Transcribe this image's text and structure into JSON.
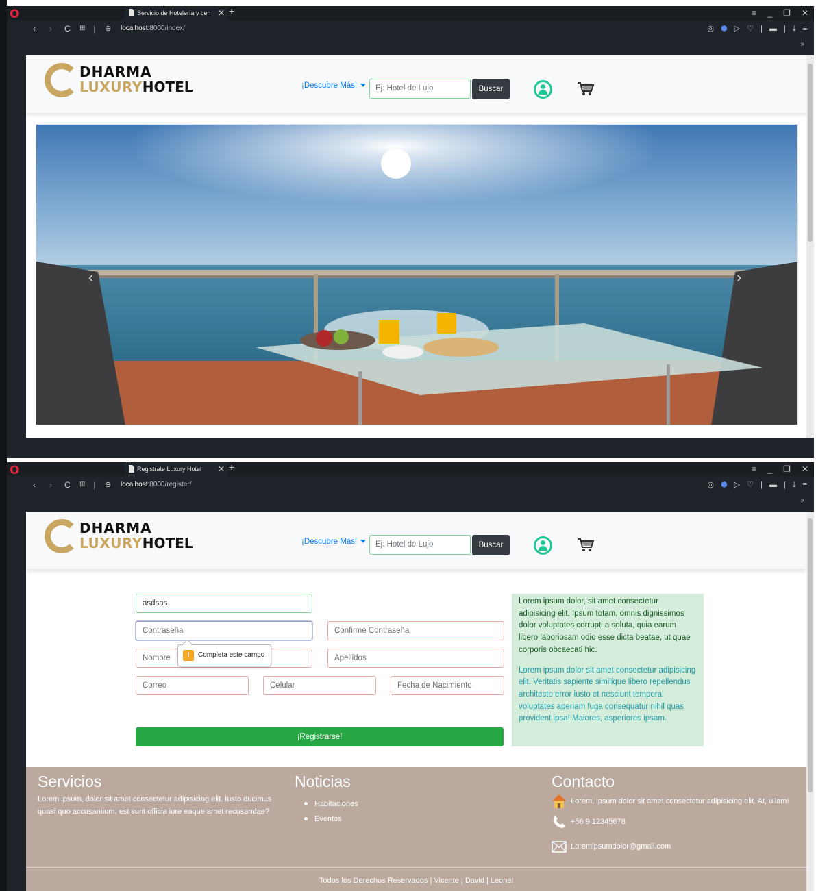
{
  "windows": [
    {
      "tab_title": "Servicio de Hotelería y cen",
      "url_host": "localhost",
      "url_rest": ":8000/index/"
    },
    {
      "tab_title": "Registrate Luxury Hotel",
      "url_host": "localhost",
      "url_rest": ":8000/register/"
    }
  ],
  "header": {
    "logo_line1": "DHARMA",
    "logo_luxury": "LUXURY",
    "logo_hotel": "HOTEL",
    "discover_label": "¡Descubre Más!",
    "search_placeholder": "Ej: Hotel de Lujo",
    "search_button": "Buscar"
  },
  "register": {
    "username_value": "asdsas",
    "password_placeholder": "Contraseña",
    "confirm_placeholder": "Confirme Contraseña",
    "nombre_placeholder": "Nombre",
    "apellidos_placeholder": "Apellidos",
    "correo_placeholder": "Correo",
    "celular_placeholder": "Celular",
    "fecha_placeholder": "Fecha de Nacimiento",
    "submit_label": "¡Registrarse!",
    "validation_tooltip": "Completa este campo"
  },
  "info_panel": {
    "paragraph1": "Lorem ipsum dolor, sit amet consectetur adipisicing elit. Ipsum totam, omnis dignissimos dolor voluptates corrupti a soluta, quia earum libero laboriosam odio esse dicta beatae, ut quae corporis obcaecati hic.",
    "paragraph2": "Lorem ipsum dolor sit amet consectetur adipisicing elit. Veritatis sapiente similique libero repellendus architecto error iusto et nesciunt tempora, voluptates aperiam fuga consequatur nihil quas provident ipsa! Maiores, asperiores ipsam."
  },
  "footer": {
    "servicios_title": "Servicios",
    "servicios_text": "Lorem ipsum, dolor sit amet consectetur adipisicing elit. Iusto ducimus quasi quo accusantium, est sunt officia iure eaque amet recusandae?",
    "noticias_title": "Noticias",
    "noticias_items": [
      "Habitaciones",
      "Eventos"
    ],
    "contacto_title": "Contacto",
    "contact_address": "Lorem, ipsum dolor sit amet consectetur adipisicing elit. At, ullam!",
    "contact_phone": "+56 9 12345678",
    "contact_email": "Loremipsumdolor@gmail.com",
    "copyright": "Todos los Derechos Reservados | Vicente | David | Leonel"
  },
  "colors": {
    "accent_green": "#28a745",
    "logo_gold": "#c9a763",
    "footer_bg": "#bba9a0",
    "panel_bg": "#d4edda",
    "user_icon": "#20c997"
  },
  "icons": [
    "opera-logo-icon",
    "back-icon",
    "forward-icon",
    "reload-icon",
    "speed-dial-icon",
    "globe-icon",
    "camera-icon",
    "shield-icon",
    "play-icon",
    "heart-icon",
    "wallet-icon",
    "download-icon",
    "menu-icon",
    "user-circle-icon",
    "cart-icon",
    "house-icon",
    "phone-icon",
    "envelope-icon"
  ]
}
